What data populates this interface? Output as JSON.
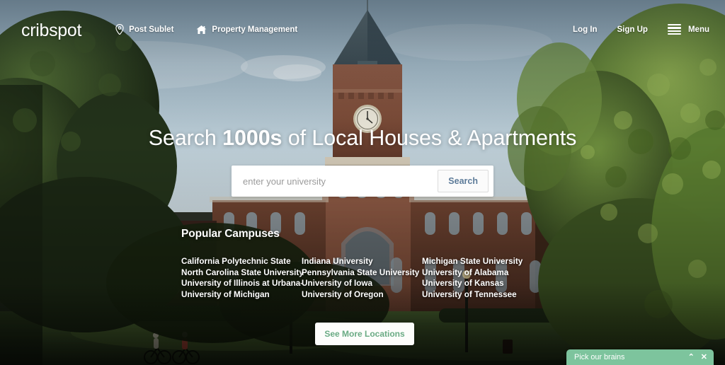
{
  "site": {
    "logo_crib": "crib",
    "logo_spot": "spot"
  },
  "header": {
    "nav_left": [
      {
        "label": "Post Sublet",
        "icon": "map-pin-icon"
      },
      {
        "label": "Property Management",
        "icon": "house-icon"
      }
    ],
    "login_label": "Log In",
    "signup_label": "Sign Up",
    "menu_label": "Menu",
    "menu_icon": "hamburger-icon"
  },
  "hero": {
    "headline_pre": "Search ",
    "headline_bold": "1000s",
    "headline_post": " of Local Houses & Apartments",
    "search_placeholder": "enter your university",
    "search_value": "",
    "search_button": "Search"
  },
  "campuses": {
    "title": "Popular Campuses",
    "columns": [
      [
        "California Polytechnic State",
        "North Carolina State University",
        "University of Illinois at Urbana-",
        "University of Michigan"
      ],
      [
        "Indiana University",
        "Pennsylvania State University",
        "University of Iowa",
        "University of Oregon"
      ],
      [
        "Michigan State University",
        "University of Alabama",
        "University of Kansas",
        "University of Tennessee"
      ]
    ],
    "more_button": "See More Locations"
  },
  "chat_widget": {
    "title": "Pick our brains",
    "collapse_icon": "chevron-up-icon",
    "close_icon": "close-icon",
    "collapse_glyph": "⌃",
    "close_glyph": "✕",
    "color": "#7dc49d"
  },
  "colors": {
    "accent_green": "#6aab84",
    "search_button_text": "#5d7b99",
    "text_on_photo": "#ffffff"
  }
}
